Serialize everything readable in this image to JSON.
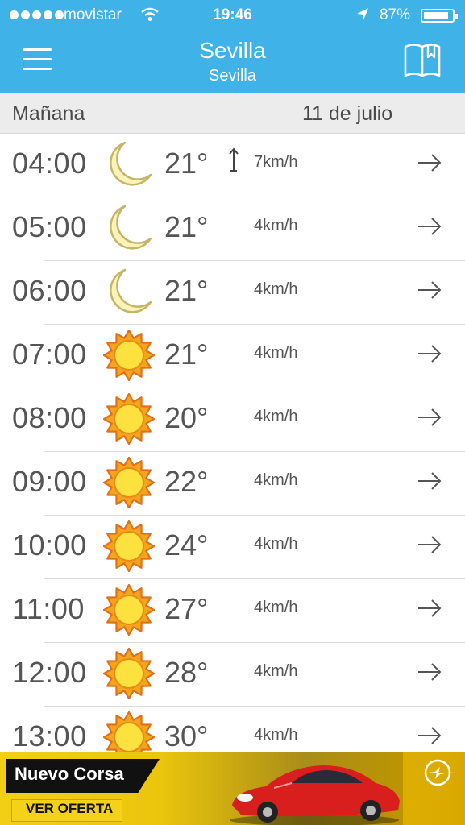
{
  "status_bar": {
    "carrier": "movistar",
    "time": "19:46",
    "battery": "87%",
    "battery_level": 0.87
  },
  "header": {
    "title": "Sevilla",
    "subtitle": "Sevilla",
    "menu_icon": "hamburger-menu-icon",
    "book_icon": "book-bookmark-icon",
    "accent_color": "#3fb2e8"
  },
  "day": {
    "label": "Mañana",
    "date": "11 de julio"
  },
  "hours": [
    {
      "hour": "04:00",
      "icon": "moon",
      "temp": "21°",
      "wind": "7km/h",
      "wind_dir_arrow": true
    },
    {
      "hour": "05:00",
      "icon": "moon",
      "temp": "21°",
      "wind": "4km/h",
      "wind_dir_arrow": false
    },
    {
      "hour": "06:00",
      "icon": "moon",
      "temp": "21°",
      "wind": "4km/h",
      "wind_dir_arrow": false
    },
    {
      "hour": "07:00",
      "icon": "sun",
      "temp": "21°",
      "wind": "4km/h",
      "wind_dir_arrow": false
    },
    {
      "hour": "08:00",
      "icon": "sun",
      "temp": "20°",
      "wind": "4km/h",
      "wind_dir_arrow": false
    },
    {
      "hour": "09:00",
      "icon": "sun",
      "temp": "22°",
      "wind": "4km/h",
      "wind_dir_arrow": false
    },
    {
      "hour": "10:00",
      "icon": "sun",
      "temp": "24°",
      "wind": "4km/h",
      "wind_dir_arrow": false
    },
    {
      "hour": "11:00",
      "icon": "sun",
      "temp": "27°",
      "wind": "4km/h",
      "wind_dir_arrow": false
    },
    {
      "hour": "12:00",
      "icon": "sun",
      "temp": "28°",
      "wind": "4km/h",
      "wind_dir_arrow": false
    },
    {
      "hour": "13:00",
      "icon": "sun",
      "temp": "30°",
      "wind": "4km/h",
      "wind_dir_arrow": false
    }
  ],
  "ad": {
    "headline": "Nuevo Corsa",
    "cta": "VER OFERTA",
    "brand_color": "#f2cf15"
  }
}
